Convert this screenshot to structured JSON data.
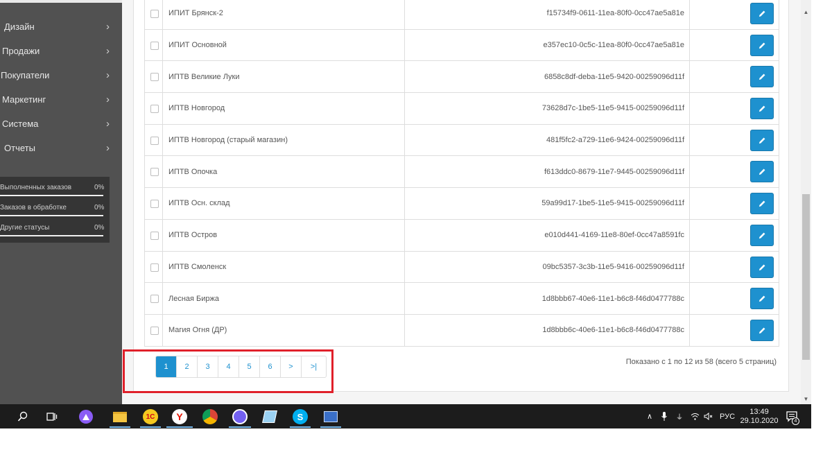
{
  "sidebar": {
    "menu": [
      {
        "label": "Дизайн"
      },
      {
        "label": "Продажи"
      },
      {
        "label": "Покупатели"
      },
      {
        "label": "Маркетинг"
      },
      {
        "label": "Система"
      },
      {
        "label": "Отчеты"
      }
    ],
    "stats": [
      {
        "label": "Выполненных заказов",
        "value": "0%"
      },
      {
        "label": "Заказов в обработке",
        "value": "0%"
      },
      {
        "label": "Другие статусы",
        "value": "0%"
      }
    ]
  },
  "table": {
    "rows": [
      {
        "name": "ИПИТ Брянск-2",
        "code": "f15734f9-0611-11ea-80f0-0cc47ae5a81e"
      },
      {
        "name": "ИПИТ Основной",
        "code": "e357ec10-0c5c-11ea-80f0-0cc47ae5a81e"
      },
      {
        "name": "ИПТВ Великие Луки",
        "code": "6858c8df-deba-11e5-9420-00259096d11f"
      },
      {
        "name": "ИПТВ Новгород",
        "code": "73628d7c-1be5-11e5-9415-00259096d11f"
      },
      {
        "name": "ИПТВ Новгород (старый магазин)",
        "code": "481f5fc2-a729-11e6-9424-00259096d11f"
      },
      {
        "name": "ИПТВ Опочка",
        "code": "f613ddc0-8679-11e7-9445-00259096d11f"
      },
      {
        "name": "ИПТВ Осн. склад",
        "code": "59a99d17-1be5-11e5-9415-00259096d11f"
      },
      {
        "name": "ИПТВ Остров",
        "code": "e010d441-4169-11e8-80ef-0cc47a8591fc"
      },
      {
        "name": "ИПТВ Смоленск",
        "code": "09bc5357-3c3b-11e5-9416-00259096d11f"
      },
      {
        "name": "Лесная Биржа",
        "code": "1d8bbb67-40e6-11e1-b6c8-f46d0477788c"
      },
      {
        "name": "Магия Огня (ДР)",
        "code": "1d8bbb6c-40e6-11e1-b6c8-f46d0477788c"
      }
    ]
  },
  "pagination": {
    "pages": [
      "1",
      "2",
      "3",
      "4",
      "5",
      "6",
      ">",
      ">|"
    ],
    "active": "1",
    "summary": "Показано с 1 по 12 из 58 (всего 5 страниц)"
  },
  "taskbar": {
    "language": "РУС",
    "time": "13:49",
    "date": "29.10.2020",
    "notifications": "4"
  },
  "colors": {
    "accent": "#1e91cf",
    "sidebar": "#515151",
    "highlight": "#e0202a"
  }
}
